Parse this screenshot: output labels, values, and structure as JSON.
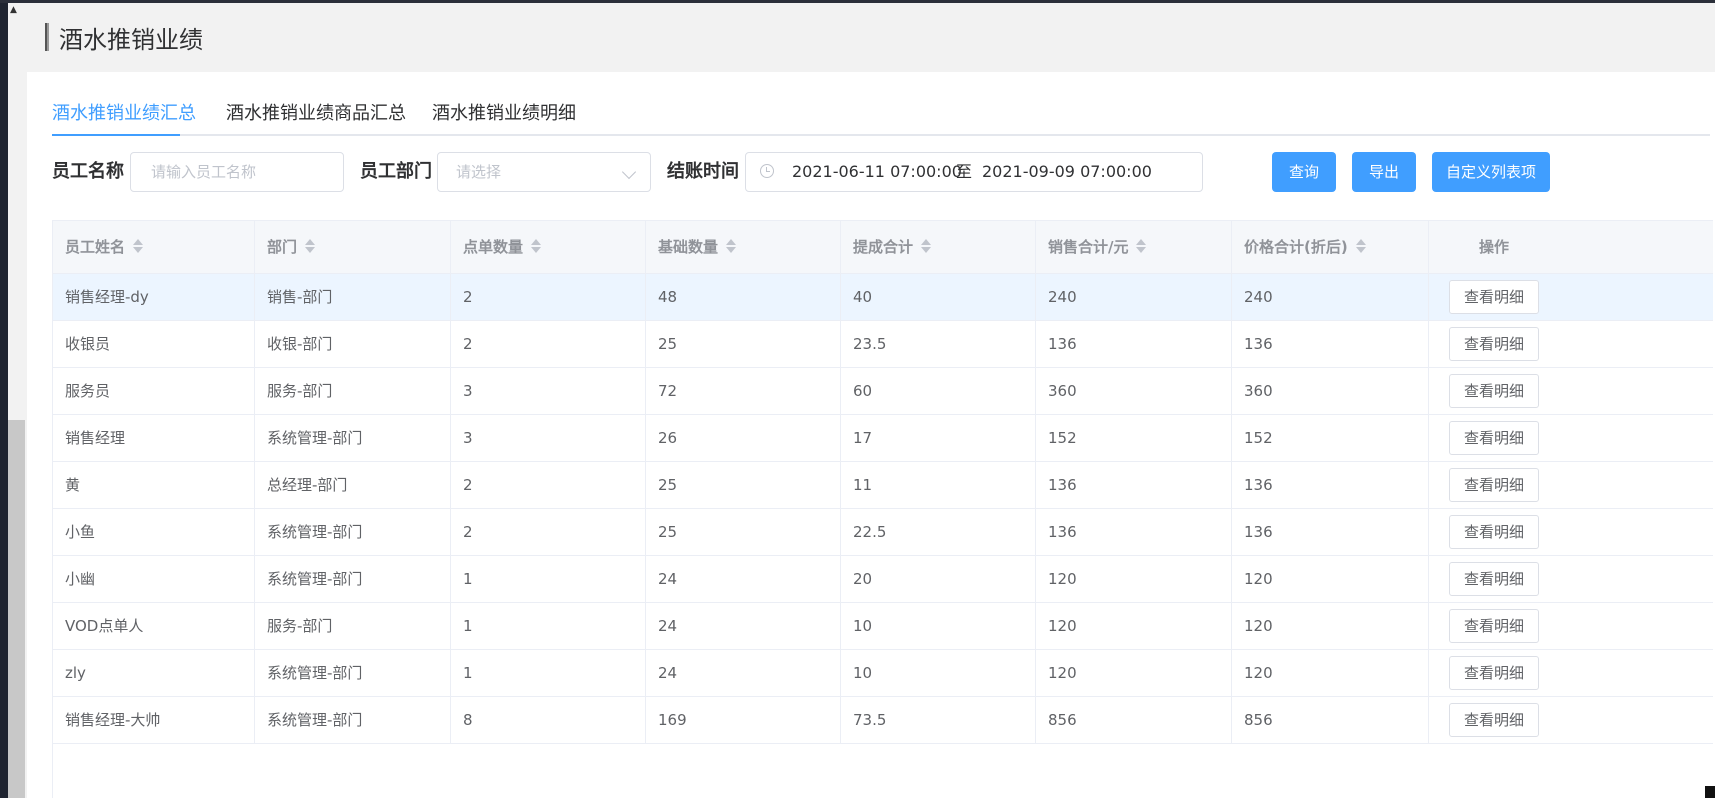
{
  "page": {
    "title": "酒水推销业绩"
  },
  "tabs": [
    {
      "label": "酒水推销业绩汇总",
      "active": true
    },
    {
      "label": "酒水推销业绩商品汇总",
      "active": false
    },
    {
      "label": "酒水推销业绩明细",
      "active": false
    }
  ],
  "filters": {
    "employee_name_label": "员工名称",
    "employee_name_placeholder": "请输入员工名称",
    "department_label": "员工部门",
    "department_placeholder": "请选择",
    "checkout_time_label": "结账时间",
    "date_start": "2021-06-11 07:00:00",
    "date_separator": "至",
    "date_end": "2021-09-09 07:00:00"
  },
  "buttons": {
    "query": "查询",
    "export": "导出",
    "custom_columns": "自定义列表项"
  },
  "table": {
    "columns": [
      "员工姓名",
      "部门",
      "点单数量",
      "基础数量",
      "提成合计",
      "销售合计/元",
      "价格合计(折后)",
      "操作"
    ],
    "action_label": "查看明细",
    "rows": [
      [
        "销售经理-dy",
        "销售-部门",
        "2",
        "48",
        "40",
        "240",
        "240"
      ],
      [
        "收银员",
        "收银-部门",
        "2",
        "25",
        "23.5",
        "136",
        "136"
      ],
      [
        "服务员",
        "服务-部门",
        "3",
        "72",
        "60",
        "360",
        "360"
      ],
      [
        "销售经理",
        "系统管理-部门",
        "3",
        "26",
        "17",
        "152",
        "152"
      ],
      [
        "黄",
        "总经理-部门",
        "2",
        "25",
        "11",
        "136",
        "136"
      ],
      [
        "小鱼",
        "系统管理-部门",
        "2",
        "25",
        "22.5",
        "136",
        "136"
      ],
      [
        "小幽",
        "系统管理-部门",
        "1",
        "24",
        "20",
        "120",
        "120"
      ],
      [
        "VOD点单人",
        "服务-部门",
        "1",
        "24",
        "10",
        "120",
        "120"
      ],
      [
        "zly",
        "系统管理-部门",
        "1",
        "24",
        "10",
        "120",
        "120"
      ],
      [
        "销售经理-大帅",
        "系统管理-部门",
        "8",
        "169",
        "73.5",
        "856",
        "856"
      ]
    ]
  },
  "colors": {
    "accent": "#409eff",
    "row_highlight": "#ecf5ff",
    "header_bg": "#f5f7fa"
  }
}
